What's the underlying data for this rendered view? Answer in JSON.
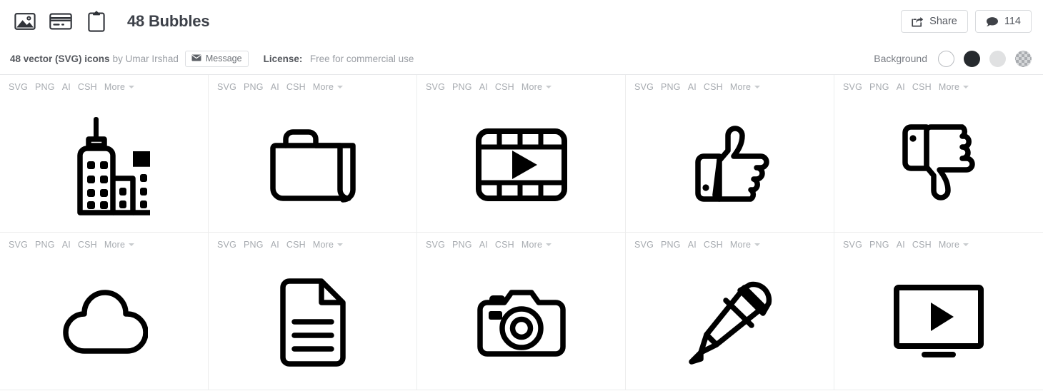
{
  "header": {
    "kind_icons": [
      {
        "name": "image-icon",
        "label": "Images"
      },
      {
        "name": "card-icon",
        "label": "Cards"
      },
      {
        "name": "clipboard-icon",
        "label": "Clipboard"
      }
    ],
    "title": "48 Bubbles",
    "share_label": "Share",
    "comments_count": "114"
  },
  "meta": {
    "pack_info_strong": "48 vector (SVG) icons",
    "pack_info_author": "by Umar Irshad",
    "message_label": "Message",
    "license_label": "License:",
    "license_value": "Free for commercial use",
    "background_label": "Background",
    "swatches": [
      {
        "name": "background-swatch-white",
        "color": "#ffffff",
        "selected": true
      },
      {
        "name": "background-swatch-black",
        "color": "#262a2e",
        "selected": false
      },
      {
        "name": "background-swatch-gray",
        "color": "#e0e1e2",
        "selected": false
      },
      {
        "name": "background-swatch-transparent",
        "color": "transparent",
        "selected": false
      }
    ]
  },
  "formats": {
    "items": [
      "SVG",
      "PNG",
      "AI",
      "CSH"
    ],
    "more": "More"
  },
  "icons": [
    {
      "name": "buildings-icon",
      "title": "Buildings"
    },
    {
      "name": "folder-icon",
      "title": "Folder"
    },
    {
      "name": "film-play-icon",
      "title": "Film play"
    },
    {
      "name": "thumbs-up-icon",
      "title": "Thumbs up"
    },
    {
      "name": "thumbs-down-icon",
      "title": "Thumbs down"
    },
    {
      "name": "cloud-icon",
      "title": "Cloud"
    },
    {
      "name": "document-icon",
      "title": "Document"
    },
    {
      "name": "camera-icon",
      "title": "Camera"
    },
    {
      "name": "pencil-icon",
      "title": "Pencil"
    },
    {
      "name": "tv-play-icon",
      "title": "TV play"
    }
  ],
  "colors": {
    "icon_stroke": "#000000",
    "text_muted": "#9a9ea4",
    "text_dark": "#3d4149",
    "border": "#eceded"
  }
}
